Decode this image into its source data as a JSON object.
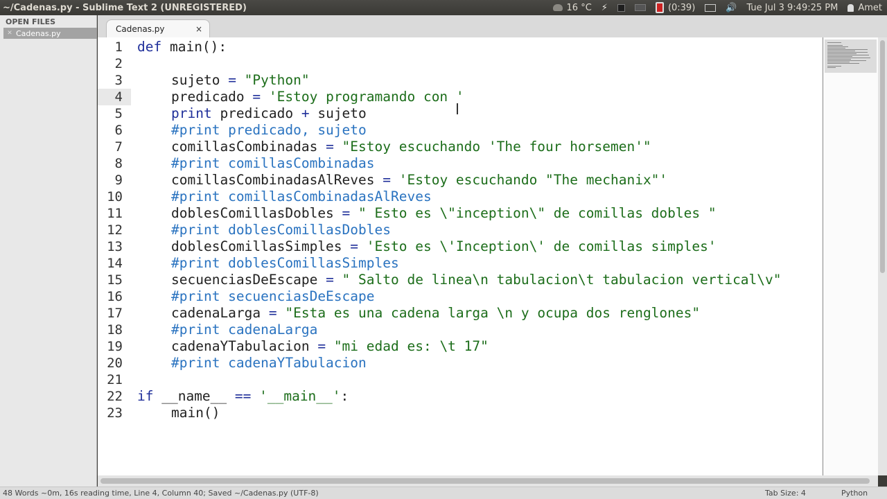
{
  "topbar": {
    "title": "~/Cadenas.py - Sublime Text 2 (UNREGISTERED)",
    "weather": "16 °C",
    "battery": "(0:39)",
    "datetime": "Tue Jul 3  9:49:25 PM",
    "user": "Amet"
  },
  "sidebar": {
    "header": "OPEN FILES",
    "files": [
      "Cadenas.py"
    ]
  },
  "tab": {
    "label": "Cadenas.py",
    "close": "×"
  },
  "editor": {
    "line_numbers": [
      "1",
      "2",
      "3",
      "4",
      "5",
      "6",
      "7",
      "8",
      "9",
      "10",
      "11",
      "12",
      "13",
      "14",
      "15",
      "16",
      "17",
      "18",
      "19",
      "20",
      "21",
      "22",
      "23"
    ],
    "current_line": "4",
    "code": {
      "l1_kw": "def",
      "l1_rest": " main():",
      "l3_a": "sujeto ",
      "l3_op": "=",
      "l3_str": " \"Python\"",
      "l4_a": "predicado ",
      "l4_op": "=",
      "l4_str": " 'Estoy programando con '",
      "l5_kw": "print",
      "l5_a": " predicado ",
      "l5_op": "+",
      "l5_b": " sujeto",
      "l6": "#print predicado, sujeto",
      "l7_a": "comillasCombinadas ",
      "l7_op": "=",
      "l7_str": " \"Estoy escuchando 'The four horsemen'\"",
      "l8": "#print comillasCombinadas",
      "l9_a": "comillasCombinadasAlReves ",
      "l9_op": "=",
      "l9_str": " 'Estoy escuchando \"The mechanix\"'",
      "l10": "#print comillasCombinadasAlReves",
      "l11_a": "doblesComillasDobles ",
      "l11_op": "=",
      "l11_str": " \" Esto es \\\"inception\\\" de comillas dobles \"",
      "l12": "#print doblesComillasDobles",
      "l13_a": "doblesComillasSimples ",
      "l13_op": "=",
      "l13_str": " 'Esto es \\'Inception\\' de comillas simples'",
      "l14": "#print doblesComillasSimples",
      "l15_a": "secuenciasDeEscape ",
      "l15_op": "=",
      "l15_str": " \" Salto de linea\\n tabulacion\\t tabulacion vertical\\v\"",
      "l16": "#print secuenciasDeEscape",
      "l17_a": "cadenaLarga ",
      "l17_op": "=",
      "l17_str": " \"Esta es una cadena larga \\n y ocupa dos renglones\"",
      "l18": "#print cadenaLarga",
      "l19_a": "cadenaYTabulacion ",
      "l19_op": "=",
      "l19_str": " \"mi edad es: \\t 17\"",
      "l20": "#print cadenaYTabulacion",
      "l22_kw": "if",
      "l22_a": " __name__ ",
      "l22_op": "==",
      "l22_str": " '__main__'",
      "l22_b": ":",
      "l23": "main()"
    }
  },
  "statusbar": {
    "text": "48 Words ~0m, 16s reading time, Line 4, Column 40; Saved ~/Cadenas.py (UTF-8)",
    "tab_size": "Tab Size: 4",
    "syntax": "Python"
  },
  "colors": {
    "keyword": "#1f2f9a",
    "string": "#1c6d1a",
    "comment": "#2a73c0"
  }
}
